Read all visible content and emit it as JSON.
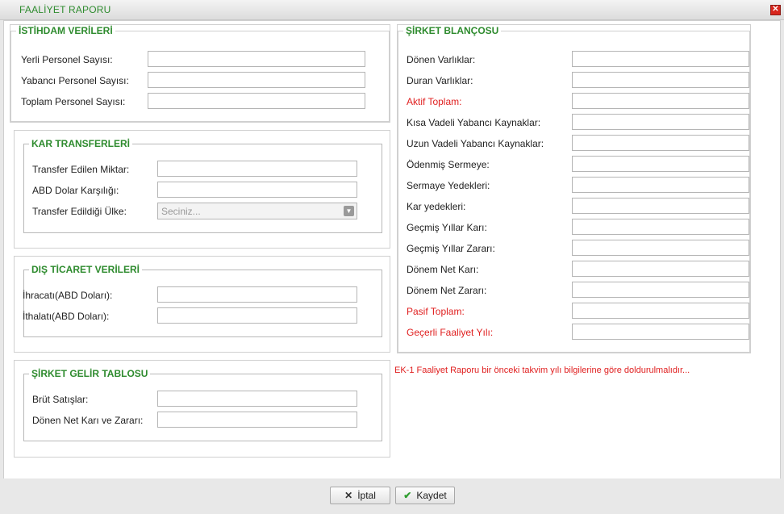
{
  "window": {
    "title": "FAALİYET RAPORU",
    "close_icon": "✕"
  },
  "istihdam": {
    "legend": "İSTİHDAM VERİLERİ",
    "rows": [
      {
        "label": "Yerli Personel Sayısı:",
        "value": ""
      },
      {
        "label": "Yabancı Personel Sayısı:",
        "value": ""
      },
      {
        "label": "Toplam Personel Sayısı:",
        "value": ""
      }
    ]
  },
  "kar_transferleri": {
    "legend": "KAR TRANSFERLERİ",
    "transfer_label": "Transfer Edilen Miktar:",
    "abd_label": "ABD Dolar Karşılığı:",
    "ulke_label": "Transfer Edildiği Ülke:",
    "ulke_selected": "Seciniz...",
    "ulke_arrow_icon": "▼"
  },
  "dis_ticaret": {
    "legend": "DIŞ TİCARET VERİLERİ",
    "rows": [
      {
        "label": "İhracatı(ABD Doları):",
        "value": ""
      },
      {
        "label": "İthalatı(ABD Doları):",
        "value": ""
      }
    ]
  },
  "gelir_tablosu": {
    "legend": "ŞİRKET GELİR TABLOSU",
    "rows": [
      {
        "label": "Brüt Satışlar:",
        "value": ""
      },
      {
        "label": "Dönen Net Karı ve Zararı:",
        "value": ""
      }
    ]
  },
  "blanco": {
    "legend": "ŞİRKET BLANÇOSU",
    "rows": [
      {
        "label": "Dönen Varlıklar:",
        "value": ""
      },
      {
        "label": "Duran Varlıklar:",
        "value": ""
      },
      {
        "label": "Aktif Toplam:",
        "value": ""
      },
      {
        "label": "Kısa Vadeli Yabancı Kaynaklar:",
        "value": ""
      },
      {
        "label": "Uzun Vadeli Yabancı Kaynaklar:",
        "value": ""
      },
      {
        "label": "Ödenmiş Sermeye:",
        "value": ""
      },
      {
        "label": "Sermaye Yedekleri:",
        "value": ""
      },
      {
        "label": "Kar yedekleri:",
        "value": ""
      },
      {
        "label": "Geçmiş Yıllar Karı:",
        "value": ""
      },
      {
        "label": "Geçmiş Yıllar Zararı:",
        "value": ""
      },
      {
        "label": "Dönem Net Karı:",
        "value": ""
      },
      {
        "label": "Dönem Net Zararı:",
        "value": ""
      },
      {
        "label": "Pasif Toplam:",
        "value": ""
      },
      {
        "label": "Geçerli Faaliyet Yılı:",
        "value": ""
      }
    ]
  },
  "note": "EK-1 Faaliyet Raporu bir önceki takvim yılı bilgilerine göre doldurulmalıdır...",
  "buttons": {
    "cancel_label": "İptal",
    "cancel_icon": "✕",
    "save_label": "Kaydet",
    "save_icon": "✔"
  },
  "colors": {
    "legend": "#2e8b2e",
    "required_label": "#e02020",
    "close": "#d8261d"
  }
}
